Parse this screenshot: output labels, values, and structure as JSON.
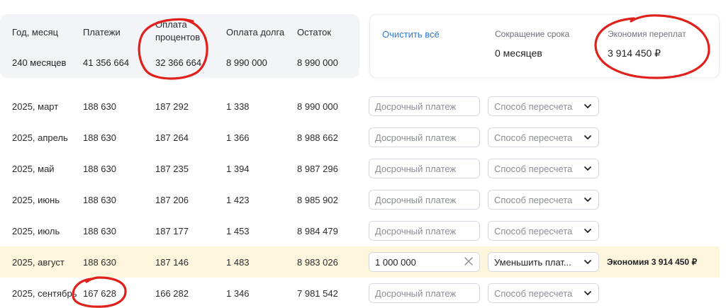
{
  "summary": {
    "headers": {
      "period": "Год, месяц",
      "payments": "Платежи",
      "interest_line1": "Оплата",
      "interest_line2": "процентов",
      "principal": "Оплата долга",
      "balance": "Остаток"
    },
    "totals": {
      "period": "240 месяцев",
      "payments": "41 356 664",
      "interest": "32 366 664",
      "principal": "8 990 000",
      "balance": "8 990 000"
    }
  },
  "panel": {
    "clear_all": "Очистить всё",
    "term_label": "Сокращение срока",
    "term_value": "0 месяцев",
    "savings_label": "Экономия переплат",
    "savings_value": "3 914 450 ₽"
  },
  "early_payment_placeholder": "Досрочный платеж",
  "recalc_placeholder": "Способ пересчета",
  "rows": [
    {
      "period": "2025, март",
      "payment": "188 630",
      "interest": "187 292",
      "principal": "1 338",
      "balance": "8 990 000",
      "early_value": "",
      "recalc_value": "Способ пересчета"
    },
    {
      "period": "2025, апрель",
      "payment": "188 630",
      "interest": "187 264",
      "principal": "1 366",
      "balance": "8 988 662",
      "early_value": "",
      "recalc_value": "Способ пересчета"
    },
    {
      "period": "2025, май",
      "payment": "188 630",
      "interest": "187 235",
      "principal": "1 394",
      "balance": "8 987 296",
      "early_value": "",
      "recalc_value": "Способ пересчета"
    },
    {
      "period": "2025, июнь",
      "payment": "188 630",
      "interest": "187 206",
      "principal": "1 423",
      "balance": "8 985 902",
      "early_value": "",
      "recalc_value": "Способ пересчета"
    },
    {
      "period": "2025, июль",
      "payment": "188 630",
      "interest": "187 177",
      "principal": "1 453",
      "balance": "8 984 479",
      "early_value": "",
      "recalc_value": "Способ пересчета"
    },
    {
      "period": "2025, август",
      "payment": "188 630",
      "interest": "187 146",
      "principal": "1 483",
      "balance": "8 983 026",
      "early_value": "1 000 000",
      "recalc_value": "Уменьшить плат...",
      "savings_note": "Экономия 3 914 450 ₽"
    },
    {
      "period": "2025, сентябрь",
      "payment": "167 628",
      "interest": "166 282",
      "principal": "1 346",
      "balance": "7 981 542",
      "early_value": "",
      "recalc_value": "Способ пересчета"
    }
  ],
  "colors": {
    "accent_link": "#2f7ad6",
    "highlight_row": "#fdf6dc",
    "annotation": "#e0201b"
  },
  "icons": {
    "clear": "close-icon",
    "dropdown": "chevron-down-icon"
  }
}
